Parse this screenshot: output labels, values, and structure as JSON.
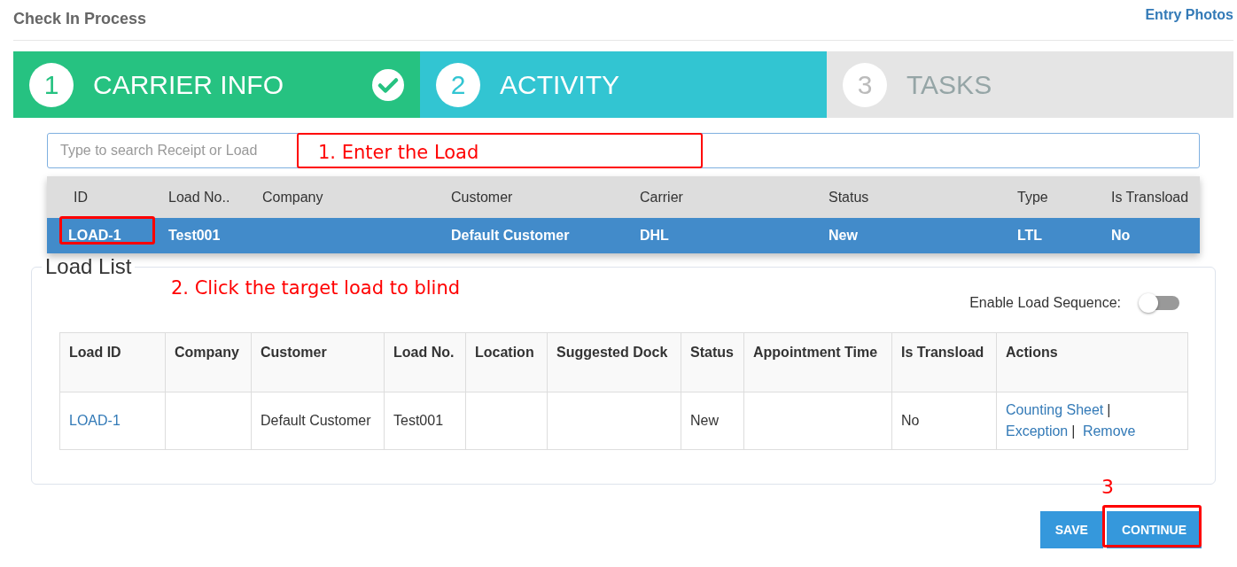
{
  "page": {
    "title": "Check In Process",
    "link": "Entry Photos"
  },
  "steps": [
    {
      "number": "1",
      "label": "CARRIER INFO",
      "completed": true,
      "selected": false
    },
    {
      "number": "2",
      "label": "ACTIVITY",
      "completed": false,
      "selected": true
    },
    {
      "number": "3",
      "label": "TASKS",
      "completed": false,
      "selected": false
    }
  ],
  "search": {
    "placeholder": "Type to search Receipt or Load"
  },
  "dropdown": {
    "columns": [
      "ID",
      "Load No..",
      "Company",
      "Customer",
      "Carrier",
      "Status",
      "Type",
      "Is Transload"
    ],
    "rows": [
      {
        "selected": true,
        "cells": [
          "LOAD-1",
          "Test001",
          "",
          "Default Customer",
          "DHL",
          "New",
          "LTL",
          "No"
        ]
      }
    ]
  },
  "load_list": {
    "title": "Load List",
    "toggle": {
      "label": "Enable Load Sequence:",
      "on": false
    },
    "columns": [
      "Load ID",
      "Company",
      "Customer",
      "Load No.",
      "Location",
      "Suggested Dock",
      "Status",
      "Appointment Time",
      "Is Transload",
      "Actions"
    ],
    "rows": [
      {
        "load_id": "LOAD-1",
        "company": "",
        "customer": "Default Customer",
        "load_no": "Test001",
        "location": "",
        "suggested_dock": "",
        "status": "New",
        "appointment_time": "",
        "is_transload": "No",
        "actions": [
          {
            "label": "Counting Sheet",
            "separator": "|"
          },
          {
            "label": "Exception",
            "separator": "|"
          },
          {
            "label": "Remove"
          }
        ]
      }
    ]
  },
  "buttons": [
    "SAVE",
    "CONTINUE"
  ],
  "annotations": [
    {
      "kind": "boxed",
      "text": "1. Enter the Load"
    },
    {
      "kind": "plain",
      "text": "2. Click the target load to blind"
    },
    {
      "kind": "number",
      "text": "3"
    }
  ]
}
